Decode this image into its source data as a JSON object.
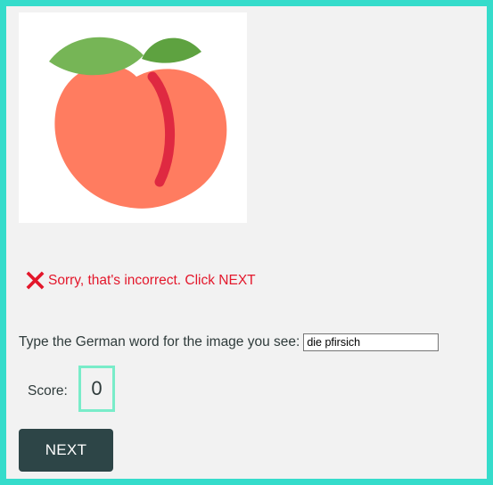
{
  "image": {
    "subject_icon": "peach-icon"
  },
  "feedback": {
    "icon": "red-x-icon",
    "message": "Sorry, that's incorrect. Click NEXT",
    "color": "#e3172b"
  },
  "question": {
    "prompt": "Type the German word for the image you see:",
    "answer_value": "die pfirsich"
  },
  "score": {
    "label": "Score:",
    "value": "0"
  },
  "next_button": {
    "label": "NEXT"
  },
  "colors": {
    "frame_border": "#35dccb",
    "score_border": "#79ecc9",
    "button_bg": "#2d4547"
  }
}
